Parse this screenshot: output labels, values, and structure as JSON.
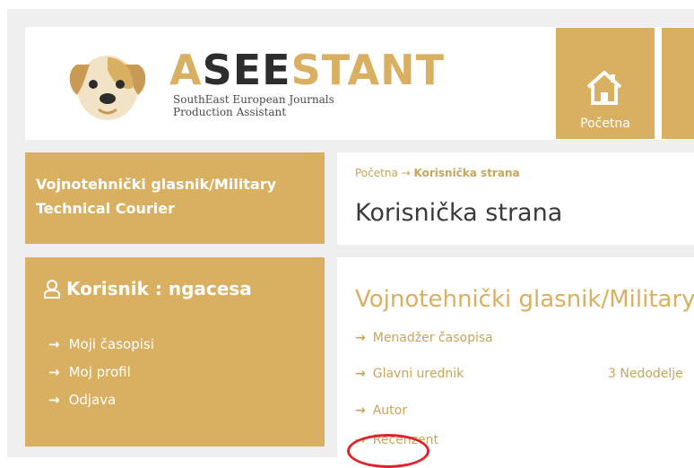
{
  "colors": {
    "accent": "#d9b062",
    "annotation": "#e0202a"
  },
  "header": {
    "brand_a": "A",
    "brand_see": "SEE",
    "brand_stant": "STANT",
    "tagline_line1": "SouthEast European Journals",
    "tagline_line2": "Production Assistant",
    "nav_home_label": "Početna",
    "nav_home_icon": "house-icon"
  },
  "sidebar": {
    "journal_line1": "Vojnotehnički glasnik/Military",
    "journal_line2": "Technical Courier",
    "user_title": "Korisnik : ngacesa",
    "user_icon": "user-icon",
    "links": [
      {
        "label": "Moji časopisi"
      },
      {
        "label": "Moj profil"
      },
      {
        "label": "Odjava"
      }
    ]
  },
  "main": {
    "breadcrumb_home": "Početna",
    "breadcrumb_current": "Korisnička strana",
    "page_title": "Korisnička strana",
    "journal_heading": "Vojnotehnički glasnik/Military",
    "roles": [
      {
        "label": "Menadžer časopisa"
      },
      {
        "label": "Glavni urednik",
        "count": "3 Nedodelje"
      },
      {
        "label": "Autor"
      },
      {
        "label": "Recenzent"
      }
    ]
  }
}
